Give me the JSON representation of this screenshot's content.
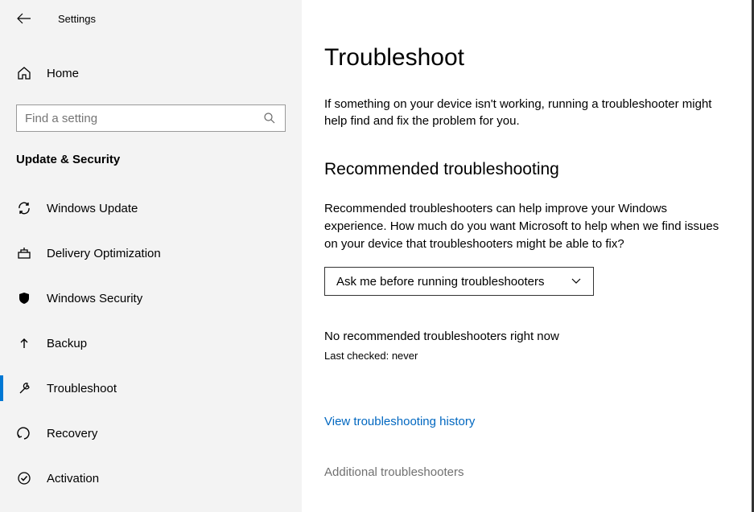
{
  "header": {
    "title": "Settings"
  },
  "home": {
    "label": "Home"
  },
  "search": {
    "placeholder": "Find a setting"
  },
  "section_label": "Update & Security",
  "nav": {
    "items": [
      {
        "label": "Windows Update"
      },
      {
        "label": "Delivery Optimization"
      },
      {
        "label": "Windows Security"
      },
      {
        "label": "Backup"
      },
      {
        "label": "Troubleshoot"
      },
      {
        "label": "Recovery"
      },
      {
        "label": "Activation"
      }
    ]
  },
  "main": {
    "title": "Troubleshoot",
    "intro": "If something on your device isn't working, running a troubleshooter might help find and fix the problem for you.",
    "rec_heading": "Recommended troubleshooting",
    "rec_text": "Recommended troubleshooters can help improve your Windows experience. How much do you want Microsoft to help when we find issues on your device that troubleshooters might be able to fix?",
    "dropdown_value": "Ask me before running troubleshooters",
    "no_recommended": "No recommended troubleshooters right now",
    "last_checked": "Last checked: never",
    "history_link": "View troubleshooting history",
    "additional": "Additional troubleshooters"
  }
}
